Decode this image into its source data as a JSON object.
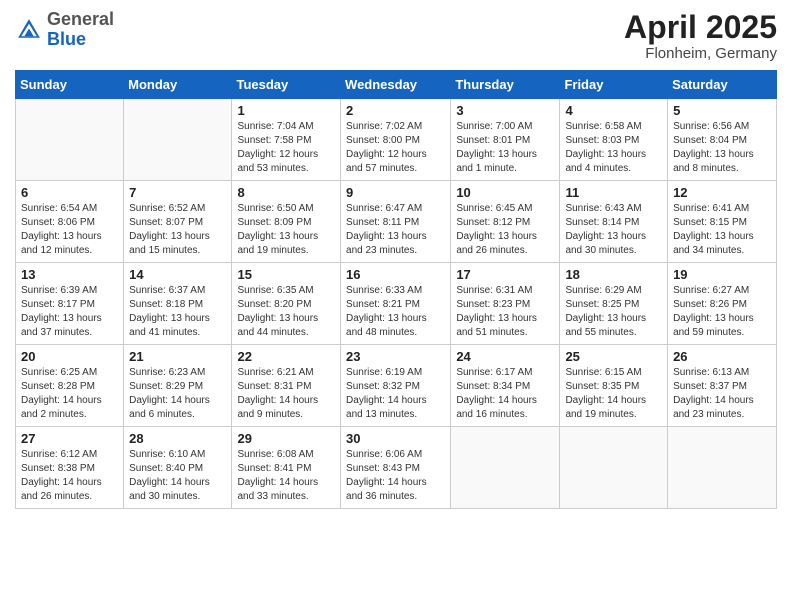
{
  "header": {
    "logo_general": "General",
    "logo_blue": "Blue",
    "month_title": "April 2025",
    "location": "Flonheim, Germany"
  },
  "days_of_week": [
    "Sunday",
    "Monday",
    "Tuesday",
    "Wednesday",
    "Thursday",
    "Friday",
    "Saturday"
  ],
  "weeks": [
    [
      {
        "day": "",
        "info": ""
      },
      {
        "day": "",
        "info": ""
      },
      {
        "day": "1",
        "info": "Sunrise: 7:04 AM\nSunset: 7:58 PM\nDaylight: 12 hours and 53 minutes."
      },
      {
        "day": "2",
        "info": "Sunrise: 7:02 AM\nSunset: 8:00 PM\nDaylight: 12 hours and 57 minutes."
      },
      {
        "day": "3",
        "info": "Sunrise: 7:00 AM\nSunset: 8:01 PM\nDaylight: 13 hours and 1 minute."
      },
      {
        "day": "4",
        "info": "Sunrise: 6:58 AM\nSunset: 8:03 PM\nDaylight: 13 hours and 4 minutes."
      },
      {
        "day": "5",
        "info": "Sunrise: 6:56 AM\nSunset: 8:04 PM\nDaylight: 13 hours and 8 minutes."
      }
    ],
    [
      {
        "day": "6",
        "info": "Sunrise: 6:54 AM\nSunset: 8:06 PM\nDaylight: 13 hours and 12 minutes."
      },
      {
        "day": "7",
        "info": "Sunrise: 6:52 AM\nSunset: 8:07 PM\nDaylight: 13 hours and 15 minutes."
      },
      {
        "day": "8",
        "info": "Sunrise: 6:50 AM\nSunset: 8:09 PM\nDaylight: 13 hours and 19 minutes."
      },
      {
        "day": "9",
        "info": "Sunrise: 6:47 AM\nSunset: 8:11 PM\nDaylight: 13 hours and 23 minutes."
      },
      {
        "day": "10",
        "info": "Sunrise: 6:45 AM\nSunset: 8:12 PM\nDaylight: 13 hours and 26 minutes."
      },
      {
        "day": "11",
        "info": "Sunrise: 6:43 AM\nSunset: 8:14 PM\nDaylight: 13 hours and 30 minutes."
      },
      {
        "day": "12",
        "info": "Sunrise: 6:41 AM\nSunset: 8:15 PM\nDaylight: 13 hours and 34 minutes."
      }
    ],
    [
      {
        "day": "13",
        "info": "Sunrise: 6:39 AM\nSunset: 8:17 PM\nDaylight: 13 hours and 37 minutes."
      },
      {
        "day": "14",
        "info": "Sunrise: 6:37 AM\nSunset: 8:18 PM\nDaylight: 13 hours and 41 minutes."
      },
      {
        "day": "15",
        "info": "Sunrise: 6:35 AM\nSunset: 8:20 PM\nDaylight: 13 hours and 44 minutes."
      },
      {
        "day": "16",
        "info": "Sunrise: 6:33 AM\nSunset: 8:21 PM\nDaylight: 13 hours and 48 minutes."
      },
      {
        "day": "17",
        "info": "Sunrise: 6:31 AM\nSunset: 8:23 PM\nDaylight: 13 hours and 51 minutes."
      },
      {
        "day": "18",
        "info": "Sunrise: 6:29 AM\nSunset: 8:25 PM\nDaylight: 13 hours and 55 minutes."
      },
      {
        "day": "19",
        "info": "Sunrise: 6:27 AM\nSunset: 8:26 PM\nDaylight: 13 hours and 59 minutes."
      }
    ],
    [
      {
        "day": "20",
        "info": "Sunrise: 6:25 AM\nSunset: 8:28 PM\nDaylight: 14 hours and 2 minutes."
      },
      {
        "day": "21",
        "info": "Sunrise: 6:23 AM\nSunset: 8:29 PM\nDaylight: 14 hours and 6 minutes."
      },
      {
        "day": "22",
        "info": "Sunrise: 6:21 AM\nSunset: 8:31 PM\nDaylight: 14 hours and 9 minutes."
      },
      {
        "day": "23",
        "info": "Sunrise: 6:19 AM\nSunset: 8:32 PM\nDaylight: 14 hours and 13 minutes."
      },
      {
        "day": "24",
        "info": "Sunrise: 6:17 AM\nSunset: 8:34 PM\nDaylight: 14 hours and 16 minutes."
      },
      {
        "day": "25",
        "info": "Sunrise: 6:15 AM\nSunset: 8:35 PM\nDaylight: 14 hours and 19 minutes."
      },
      {
        "day": "26",
        "info": "Sunrise: 6:13 AM\nSunset: 8:37 PM\nDaylight: 14 hours and 23 minutes."
      }
    ],
    [
      {
        "day": "27",
        "info": "Sunrise: 6:12 AM\nSunset: 8:38 PM\nDaylight: 14 hours and 26 minutes."
      },
      {
        "day": "28",
        "info": "Sunrise: 6:10 AM\nSunset: 8:40 PM\nDaylight: 14 hours and 30 minutes."
      },
      {
        "day": "29",
        "info": "Sunrise: 6:08 AM\nSunset: 8:41 PM\nDaylight: 14 hours and 33 minutes."
      },
      {
        "day": "30",
        "info": "Sunrise: 6:06 AM\nSunset: 8:43 PM\nDaylight: 14 hours and 36 minutes."
      },
      {
        "day": "",
        "info": ""
      },
      {
        "day": "",
        "info": ""
      },
      {
        "day": "",
        "info": ""
      }
    ]
  ]
}
